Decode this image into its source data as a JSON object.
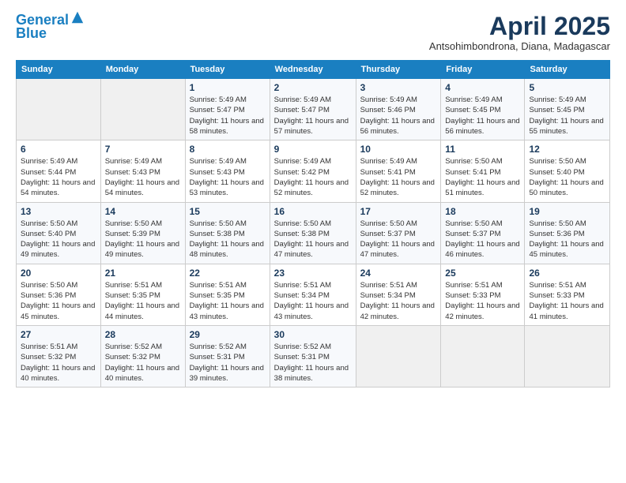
{
  "header": {
    "logo_line1": "General",
    "logo_line2": "Blue",
    "month_title": "April 2025",
    "subtitle": "Antsohimbondrona, Diana, Madagascar"
  },
  "days_of_week": [
    "Sunday",
    "Monday",
    "Tuesday",
    "Wednesday",
    "Thursday",
    "Friday",
    "Saturday"
  ],
  "weeks": [
    [
      {
        "day": "",
        "info": ""
      },
      {
        "day": "",
        "info": ""
      },
      {
        "day": "1",
        "info": "Sunrise: 5:49 AM\nSunset: 5:47 PM\nDaylight: 11 hours and 58 minutes."
      },
      {
        "day": "2",
        "info": "Sunrise: 5:49 AM\nSunset: 5:47 PM\nDaylight: 11 hours and 57 minutes."
      },
      {
        "day": "3",
        "info": "Sunrise: 5:49 AM\nSunset: 5:46 PM\nDaylight: 11 hours and 56 minutes."
      },
      {
        "day": "4",
        "info": "Sunrise: 5:49 AM\nSunset: 5:45 PM\nDaylight: 11 hours and 56 minutes."
      },
      {
        "day": "5",
        "info": "Sunrise: 5:49 AM\nSunset: 5:45 PM\nDaylight: 11 hours and 55 minutes."
      }
    ],
    [
      {
        "day": "6",
        "info": "Sunrise: 5:49 AM\nSunset: 5:44 PM\nDaylight: 11 hours and 54 minutes."
      },
      {
        "day": "7",
        "info": "Sunrise: 5:49 AM\nSunset: 5:43 PM\nDaylight: 11 hours and 54 minutes."
      },
      {
        "day": "8",
        "info": "Sunrise: 5:49 AM\nSunset: 5:43 PM\nDaylight: 11 hours and 53 minutes."
      },
      {
        "day": "9",
        "info": "Sunrise: 5:49 AM\nSunset: 5:42 PM\nDaylight: 11 hours and 52 minutes."
      },
      {
        "day": "10",
        "info": "Sunrise: 5:49 AM\nSunset: 5:41 PM\nDaylight: 11 hours and 52 minutes."
      },
      {
        "day": "11",
        "info": "Sunrise: 5:50 AM\nSunset: 5:41 PM\nDaylight: 11 hours and 51 minutes."
      },
      {
        "day": "12",
        "info": "Sunrise: 5:50 AM\nSunset: 5:40 PM\nDaylight: 11 hours and 50 minutes."
      }
    ],
    [
      {
        "day": "13",
        "info": "Sunrise: 5:50 AM\nSunset: 5:40 PM\nDaylight: 11 hours and 49 minutes."
      },
      {
        "day": "14",
        "info": "Sunrise: 5:50 AM\nSunset: 5:39 PM\nDaylight: 11 hours and 49 minutes."
      },
      {
        "day": "15",
        "info": "Sunrise: 5:50 AM\nSunset: 5:38 PM\nDaylight: 11 hours and 48 minutes."
      },
      {
        "day": "16",
        "info": "Sunrise: 5:50 AM\nSunset: 5:38 PM\nDaylight: 11 hours and 47 minutes."
      },
      {
        "day": "17",
        "info": "Sunrise: 5:50 AM\nSunset: 5:37 PM\nDaylight: 11 hours and 47 minutes."
      },
      {
        "day": "18",
        "info": "Sunrise: 5:50 AM\nSunset: 5:37 PM\nDaylight: 11 hours and 46 minutes."
      },
      {
        "day": "19",
        "info": "Sunrise: 5:50 AM\nSunset: 5:36 PM\nDaylight: 11 hours and 45 minutes."
      }
    ],
    [
      {
        "day": "20",
        "info": "Sunrise: 5:50 AM\nSunset: 5:36 PM\nDaylight: 11 hours and 45 minutes."
      },
      {
        "day": "21",
        "info": "Sunrise: 5:51 AM\nSunset: 5:35 PM\nDaylight: 11 hours and 44 minutes."
      },
      {
        "day": "22",
        "info": "Sunrise: 5:51 AM\nSunset: 5:35 PM\nDaylight: 11 hours and 43 minutes."
      },
      {
        "day": "23",
        "info": "Sunrise: 5:51 AM\nSunset: 5:34 PM\nDaylight: 11 hours and 43 minutes."
      },
      {
        "day": "24",
        "info": "Sunrise: 5:51 AM\nSunset: 5:34 PM\nDaylight: 11 hours and 42 minutes."
      },
      {
        "day": "25",
        "info": "Sunrise: 5:51 AM\nSunset: 5:33 PM\nDaylight: 11 hours and 42 minutes."
      },
      {
        "day": "26",
        "info": "Sunrise: 5:51 AM\nSunset: 5:33 PM\nDaylight: 11 hours and 41 minutes."
      }
    ],
    [
      {
        "day": "27",
        "info": "Sunrise: 5:51 AM\nSunset: 5:32 PM\nDaylight: 11 hours and 40 minutes."
      },
      {
        "day": "28",
        "info": "Sunrise: 5:52 AM\nSunset: 5:32 PM\nDaylight: 11 hours and 40 minutes."
      },
      {
        "day": "29",
        "info": "Sunrise: 5:52 AM\nSunset: 5:31 PM\nDaylight: 11 hours and 39 minutes."
      },
      {
        "day": "30",
        "info": "Sunrise: 5:52 AM\nSunset: 5:31 PM\nDaylight: 11 hours and 38 minutes."
      },
      {
        "day": "",
        "info": ""
      },
      {
        "day": "",
        "info": ""
      },
      {
        "day": "",
        "info": ""
      }
    ]
  ]
}
